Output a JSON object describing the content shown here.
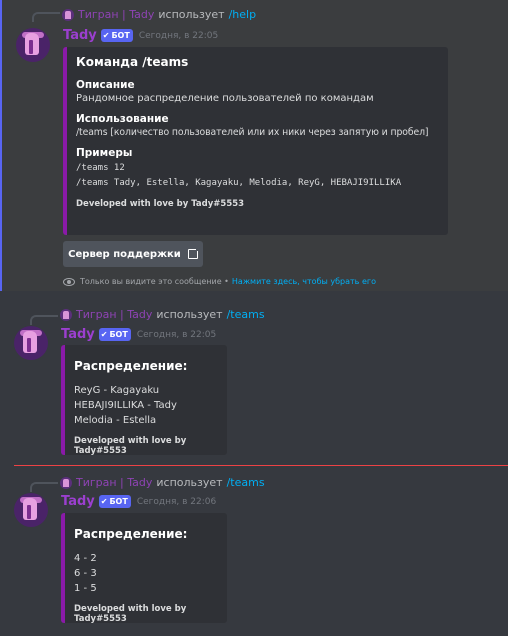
{
  "messages": [
    {
      "reply": {
        "user": "Тигран | Tady",
        "uses": "использует",
        "command": "/help"
      },
      "author": "Tady",
      "bot_badge": "БОТ",
      "time": "Сегодня, в 22:05",
      "embed": {
        "title": "Команда /teams",
        "fields": [
          {
            "name": "Описание",
            "value": "Рандомное распределение пользователей по командам"
          },
          {
            "name": "Использование",
            "value": "/teams [количество пользователей или их ники через запятую и пробел]"
          },
          {
            "name": "Примеры",
            "code": [
              "/teams 12",
              "/teams Tady, Estella, Kagayaku, Melodia, ReyG, HEBAJI9ILLIKA"
            ]
          }
        ],
        "footer": "Developed with love by Tady#5553"
      },
      "button_label": "Сервер поддержки",
      "ephemeral_note": "Только вы видите это сообщение •",
      "ephemeral_dismiss": "Нажмите здесь, чтобы убрать его"
    },
    {
      "reply": {
        "user": "Тигран | Tady",
        "uses": "использует",
        "command": "/teams"
      },
      "author": "Tady",
      "bot_badge": "БОТ",
      "time": "Сегодня, в 22:05",
      "embed": {
        "title": "Распределение:",
        "lines": [
          "ReyG - Kagayaku",
          "HEBAJI9ILLIKA - Tady",
          "Melodia - Estella"
        ],
        "footer": "Developed with love by Tady#5553"
      }
    },
    {
      "reply": {
        "user": "Тигран | Tady",
        "uses": "использует",
        "command": "/teams"
      },
      "author": "Tady",
      "bot_badge": "БОТ",
      "time": "Сегодня, в 22:06",
      "embed": {
        "title": "Распределение:",
        "lines": [
          "4 - 2",
          "6 - 3",
          "1 - 5"
        ],
        "footer": "Developed with love by Tady#5553"
      }
    }
  ]
}
